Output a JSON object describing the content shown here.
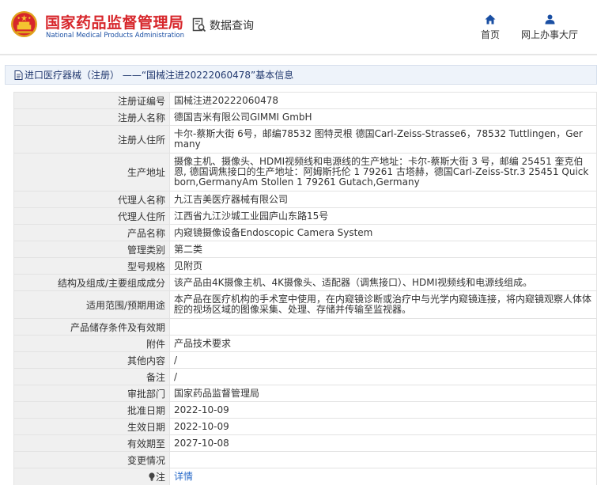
{
  "header": {
    "brand_cn": "国家药品监督管理局",
    "brand_en": "National Medical Products Administration",
    "query_label": "数据查询",
    "nav": {
      "home_label": "首页",
      "online_label": "网上办事大厅"
    }
  },
  "title_bar": {
    "text": "进口医疗器械（注册） ——“国械注进20222060478”基本信息"
  },
  "rows": [
    {
      "label": "注册证编号",
      "value": "国械注进20222060478"
    },
    {
      "label": "注册人名称",
      "value": "德国吉米有限公司GIMMI GmbH"
    },
    {
      "label": "注册人住所",
      "value": "卡尔-蔡斯大街 6号，邮编78532 图特灵根 德国Carl-Zeiss-Strasse6，78532 Tuttlingen，Germany"
    },
    {
      "label": "生产地址",
      "value": "摄像主机、摄像头、HDMI视频线和电源线的生产地址：卡尔-蔡斯大街 3 号，邮编 25451 奎克伯恩, 德国调焦接口的生产地址：阿姆斯托伦 1 79261 古塔赫，德国Carl-Zeiss-Str.3 25451 Quickborn,GermanyAm Stollen 1 79261 Gutach,Germany"
    },
    {
      "label": "代理人名称",
      "value": "九江吉美医疗器械有限公司"
    },
    {
      "label": "代理人住所",
      "value": "江西省九江沙城工业园庐山东路15号"
    },
    {
      "label": "产品名称",
      "value": "内窥镜摄像设备Endoscopic Camera System"
    },
    {
      "label": "管理类别",
      "value": "第二类"
    },
    {
      "label": "型号规格",
      "value": "见附页"
    },
    {
      "label": "结构及组成/主要组成成分",
      "value": "该产品由4K摄像主机、4K摄像头、适配器（调焦接口）、HDMI视频线和电源线组成。"
    },
    {
      "label": "适用范围/预期用途",
      "value": "本产品在医疗机构的手术室中使用，在内窥镜诊断或治疗中与光学内窥镜连接，将内窥镜观察人体体腔的视场区域的图像采集、处理、存储并传输至监视器。"
    },
    {
      "label": "产品储存条件及有效期",
      "value": ""
    },
    {
      "label": "附件",
      "value": "产品技术要求"
    },
    {
      "label": "其他内容",
      "value": "/"
    },
    {
      "label": "备注",
      "value": "/"
    },
    {
      "label": "审批部门",
      "value": "国家药品监督管理局"
    },
    {
      "label": "批准日期",
      "value": "2022-10-09"
    },
    {
      "label": "生效日期",
      "value": "2022-10-09"
    },
    {
      "label": "有效期至",
      "value": "2027-10-08"
    },
    {
      "label": "变更情况",
      "value": ""
    }
  ],
  "note_row": {
    "label": "注",
    "link_text": "详情"
  },
  "colors": {
    "brand_red": "#d7262b",
    "brand_blue": "#1a4fa3",
    "link": "#2a6bc9"
  },
  "icons": [
    "emblem-logo",
    "search-doc-icon",
    "home-icon",
    "user-icon",
    "document-icon",
    "lightbulb-icon"
  ]
}
